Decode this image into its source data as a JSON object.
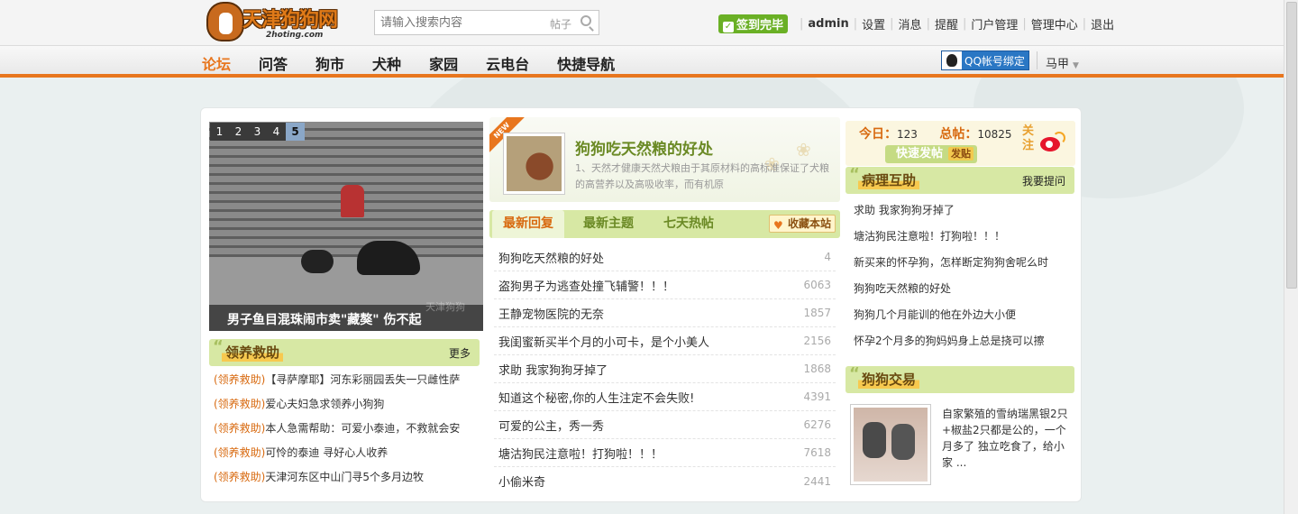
{
  "header": {
    "logo_text": "天津狗狗网",
    "logo_sub": "2hoting.com",
    "search_placeholder": "请输入搜索内容",
    "search_scope": "帖子",
    "checkin_label": "签到完毕",
    "user_links": [
      "admin",
      "设置",
      "消息",
      "提醒",
      "门户管理",
      "管理中心",
      "退出"
    ]
  },
  "nav": {
    "items": [
      "论坛",
      "问答",
      "狗市",
      "犬种",
      "家园",
      "云电台",
      "快捷导航"
    ],
    "active_index": 0,
    "qq_bind_label": "QQ帐号绑定",
    "user_name": "马甲"
  },
  "slideshow": {
    "tabs": [
      "1",
      "2",
      "3",
      "4",
      "5"
    ],
    "active_tab": "5",
    "caption": "男子鱼目混珠闹市卖\"藏獒\" 伤不起",
    "watermark": "天津狗狗"
  },
  "adopt": {
    "title": "领养救助",
    "more_label": "更多",
    "items": [
      {
        "tag": "(领养救助)",
        "text": "【寻萨摩耶】河东彩丽园丢失一只雌性萨"
      },
      {
        "tag": "(领养救助)",
        "text": "爱心夫妇急求领养小狗狗"
      },
      {
        "tag": "(领养救助)",
        "text": "本人急需帮助：可爱小泰迪，不救就会安"
      },
      {
        "tag": "(领养救助)",
        "text": "可怜的泰迪 寻好心人收养"
      },
      {
        "tag": "(领养救助)",
        "text": "天津河东区中山门寻5个多月边牧"
      }
    ]
  },
  "feature": {
    "badge": "NEW",
    "title": "狗狗吃天然粮的好处",
    "desc": "1、天然才健康天然犬粮由于其原材料的高标准保证了犬粮的高营养以及高吸收率，而有机原"
  },
  "tabs": {
    "items": [
      "最新回复",
      "最新主题",
      "七天热帖"
    ],
    "active": 0,
    "fav_label": "收藏本站"
  },
  "threads": [
    {
      "title": "狗狗吃天然粮的好处",
      "count": "4"
    },
    {
      "title": "盗狗男子为逃查处撞飞辅警！！！",
      "count": "6063"
    },
    {
      "title": "王静宠物医院的无奈",
      "count": "1857"
    },
    {
      "title": "我闺蜜新买半个月的小可卡，是个小美人",
      "count": "2156"
    },
    {
      "title": "求助 我家狗狗牙掉了",
      "count": "1868"
    },
    {
      "title": "知道这个秘密,你的人生注定不会失败!",
      "count": "4391"
    },
    {
      "title": "可爱的公主，秀一秀",
      "count": "6276"
    },
    {
      "title": "塘沽狗民注意啦！打狗啦！！！",
      "count": "7618"
    },
    {
      "title": "小偷米奇",
      "count": "2441"
    }
  ],
  "stats": {
    "today_label": "今日：",
    "today_value": "123",
    "total_label": "总帖：",
    "total_value": "10825",
    "quick_post_label": "快速发帖",
    "quick_post_tag": "发贴",
    "follow_label": "关注"
  },
  "health": {
    "title": "病理互助",
    "ask_label": "我要提问",
    "items": [
      "求助 我家狗狗牙掉了",
      "塘沽狗民注意啦！打狗啦！！！",
      "新买来的怀孕狗，怎样断定狗狗舍呢么时",
      "狗狗吃天然粮的好处",
      "狗狗几个月能训的他在外边大小便",
      "怀孕2个月多的狗妈妈身上总是挠可以擦"
    ]
  },
  "trade": {
    "title": "狗狗交易",
    "desc": "自家繁殖的雪纳瑞黑银2只+椒盐2只都是公的，一个月多了 独立吃食了，给小家 ..."
  },
  "colors": {
    "accent": "#e8761e",
    "section_green": "#d7e8a4",
    "title_green": "#6b8a25"
  }
}
